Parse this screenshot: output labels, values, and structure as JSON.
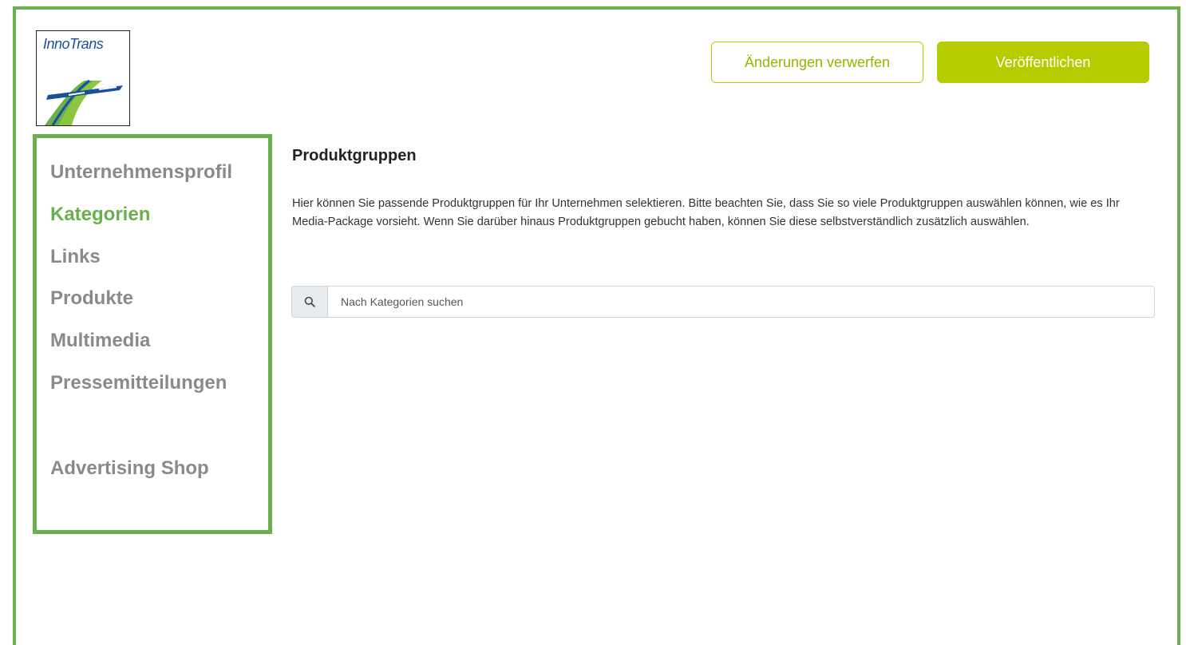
{
  "logo": {
    "text": "InnoTrans"
  },
  "header": {
    "discard_label": "Änderungen verwerfen",
    "publish_label": "Veröffentlichen"
  },
  "sidebar": {
    "items": [
      {
        "label": "Unternehmensprofil",
        "active": false
      },
      {
        "label": "Kategorien",
        "active": true
      },
      {
        "label": "Links",
        "active": false
      },
      {
        "label": "Produkte",
        "active": false
      },
      {
        "label": "Multimedia",
        "active": false
      },
      {
        "label": "Pressemitteilungen",
        "active": false
      },
      {
        "label": "Advertising Shop",
        "active": false
      }
    ]
  },
  "main": {
    "title": "Produktgruppen",
    "description": "Hier können Sie passende Produktgruppen für Ihr Unternehmen selektieren. Bitte beachten Sie, dass Sie so viele Produktgruppen auswählen können, wie es Ihr Media-Package vorsieht. Wenn Sie darüber hinaus Produktgruppen gebucht haben, können Sie diese selbstverständlich zusätzlich auswählen.",
    "search": {
      "placeholder": "Nach Kategorien suchen",
      "value": ""
    }
  },
  "colors": {
    "frame_green": "#6ab04c",
    "accent_lime": "#b5cc00",
    "nav_gray": "#8a8a8a"
  }
}
